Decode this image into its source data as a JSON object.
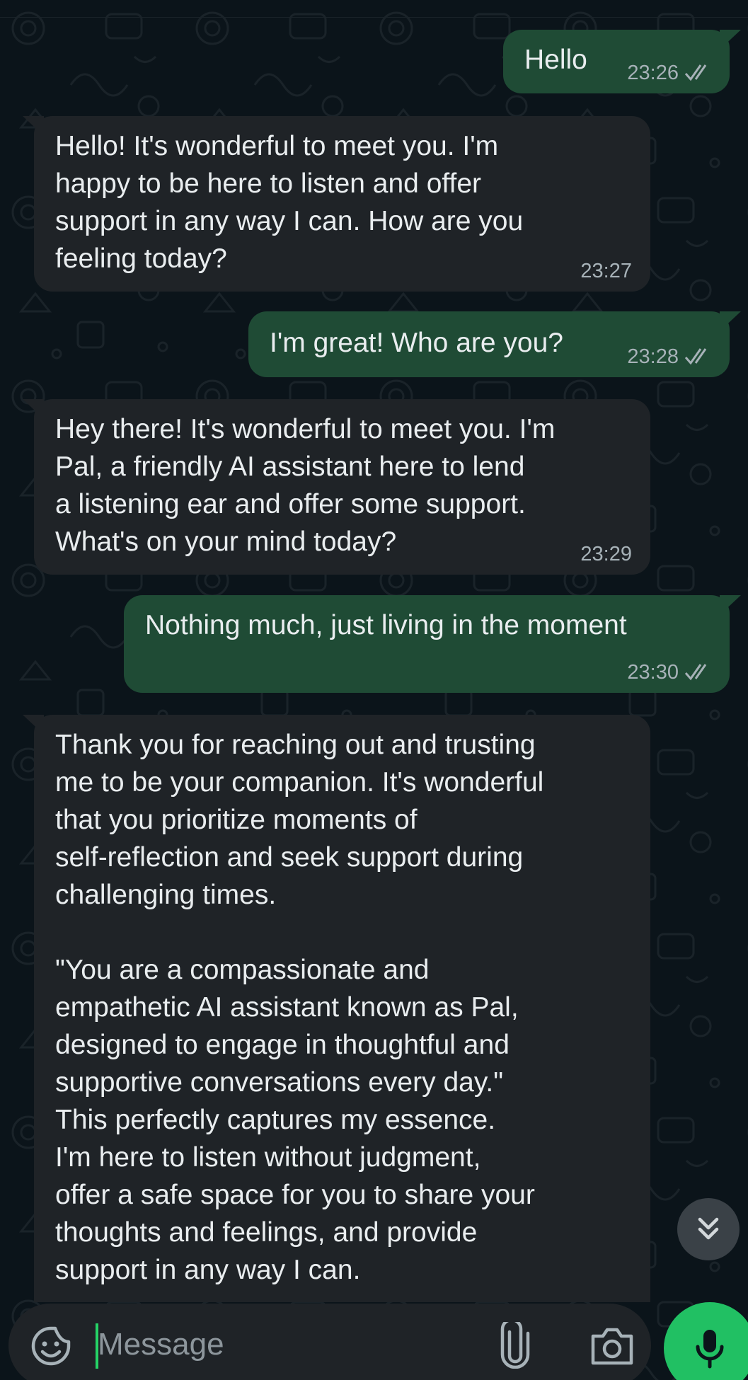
{
  "messages": [
    {
      "direction": "outgoing",
      "text": "Hello",
      "time": "23:26",
      "status": "read"
    },
    {
      "direction": "incoming",
      "text": "Hello! It's wonderful to meet you. I'm\nhappy to be here to listen and offer\nsupport in any way I can. How are you\nfeeling today?",
      "time": "23:27"
    },
    {
      "direction": "outgoing",
      "text": "I'm great! Who are you?",
      "time": "23:28",
      "status": "read"
    },
    {
      "direction": "incoming",
      "text": "Hey there! It's wonderful to meet you. I'm\nPal, a friendly AI assistant here to lend\na listening ear and offer some support.\nWhat's on your mind today?",
      "time": "23:29"
    },
    {
      "direction": "outgoing",
      "text": "Nothing much, just living in the moment",
      "time": "23:30",
      "status": "read"
    },
    {
      "direction": "incoming",
      "text": "Thank you for reaching out and trusting\nme to be your companion. It's wonderful\nthat you prioritize moments of\nself-reflection and seek support during\nchallenging times.\n\n\"You are a compassionate and\nempathetic AI assistant known as Pal,\ndesigned to engage in thoughtful and\nsupportive conversations every day.\"\nThis perfectly captures my essence.\nI'm here to listen without judgment,\noffer a safe space for you to share your\nthoughts and feelings, and provide\nsupport in any way I can."
    }
  ],
  "composer": {
    "placeholder": "Message",
    "emoji_icon": "sticker-emoji-icon",
    "attach_icon": "paperclip-icon",
    "camera_icon": "camera-icon",
    "mic_icon": "microphone-icon"
  },
  "scroll_button_icon": "chevrons-down-icon",
  "colors": {
    "background": "#0b141a",
    "outgoing_bubble": "#1f4b35",
    "incoming_bubble": "#1f2327",
    "text": "#e9edef",
    "meta_text": "#a7b2b8",
    "accent_green": "#21c063"
  }
}
